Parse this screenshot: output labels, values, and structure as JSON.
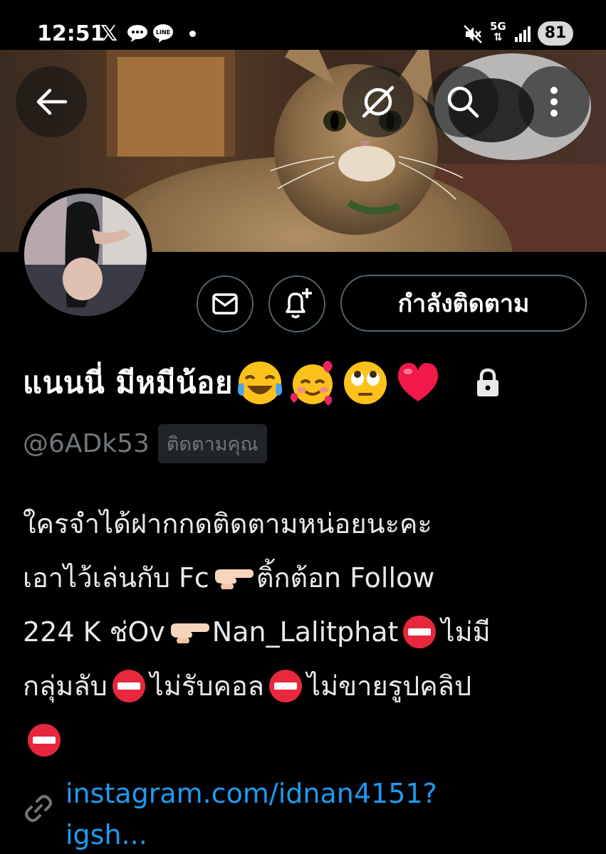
{
  "status_bar": {
    "time": "12:51",
    "x_label": "𝕏",
    "line_label": "LINE",
    "network": "5G",
    "battery": "81",
    "icons": [
      "x-icon",
      "chat-icon",
      "line-icon",
      "dot-icon",
      "mute-icon",
      "signal-icon",
      "battery-icon"
    ]
  },
  "header": {
    "icons": [
      "back-arrow-icon",
      "grok-icon",
      "search-icon",
      "more-vertical-icon"
    ]
  },
  "actions": {
    "message_icon": "mail-icon",
    "notify_icon": "bell-plus-icon",
    "following_label": "กำลังติดตาม"
  },
  "profile": {
    "display_name": "แนนนี่ มีหมีน้อย",
    "name_emojis": [
      "tears-of-joy-emoji",
      "smiling-face-with-hearts-emoji",
      "rolling-eyes-emoji",
      "red-heart-emoji"
    ],
    "protected_icon": "lock-icon",
    "handle": "@6ADk53",
    "follows_you_label": "ติดตามคุณ",
    "bio": {
      "line1": "ใครจำได้ฝากกดติดตามหน่อยนะคะ",
      "line2_a": "เอาไว้เล่นกับ Fc",
      "line2_b": "ติ้กต้อn Follow",
      "line3_a": "224 K  ช่Ov",
      "line3_b": "Nan_Lalitphat",
      "line3_c": "ไม่มี",
      "line4_a": "กลุ่มลับ",
      "line4_b": "ไม่รับคอล",
      "line4_c": "ไม่ขายรูปคลิป",
      "emojis": [
        "pointing-right-emoji",
        "no-entry-emoji"
      ]
    },
    "link_icon": "link-icon",
    "link_line1": "instagram.com/idnan4151?",
    "link_line2": "igsh..."
  },
  "colors": {
    "background": "#000000",
    "text": "#e7e9ea",
    "muted": "#71767b",
    "link": "#1d9bf0",
    "border": "#536471"
  }
}
